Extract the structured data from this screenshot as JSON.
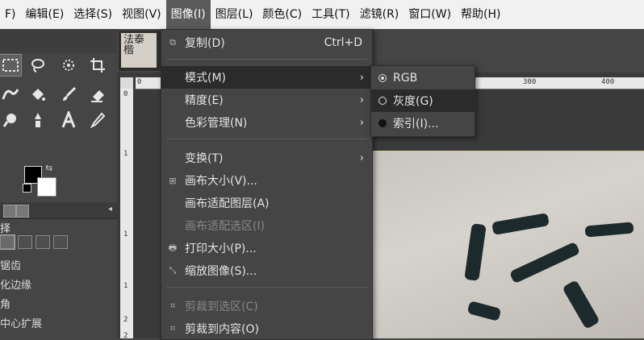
{
  "menubar": [
    {
      "label": "F)"
    },
    {
      "label": "编辑(E)"
    },
    {
      "label": "选择(S)"
    },
    {
      "label": "视图(V)"
    },
    {
      "label": "图像(I)"
    },
    {
      "label": "图层(L)"
    },
    {
      "label": "颜色(C)"
    },
    {
      "label": "工具(T)"
    },
    {
      "label": "滤镜(R)"
    },
    {
      "label": "窗口(W)"
    },
    {
      "label": "帮助(H)"
    }
  ],
  "image_menu": {
    "copy": {
      "label": "复制(D)",
      "shortcut": "Ctrl+D"
    },
    "mode": {
      "label": "模式(M)"
    },
    "precision": {
      "label": "精度(E)"
    },
    "color_mgmt": {
      "label": "色彩管理(N)"
    },
    "transform": {
      "label": "变换(T)"
    },
    "canvas_size": {
      "label": "画布大小(V)..."
    },
    "fit_canvas_layers": {
      "label": "画布适配图层(A)"
    },
    "fit_canvas_selection": {
      "label": "画布适配选区(I)"
    },
    "print_size": {
      "label": "打印大小(P)..."
    },
    "scale_image": {
      "label": "缩放图像(S)..."
    },
    "crop_selection": {
      "label": "剪裁到选区(C)"
    },
    "crop_content": {
      "label": "剪裁到内容(O)"
    }
  },
  "mode_submenu": [
    {
      "label": "RGB"
    },
    {
      "label": "灰度(G)"
    },
    {
      "label": "索引(I)..."
    }
  ],
  "tool_options": {
    "title": "择",
    "lines": [
      "锯齿",
      "化边缘",
      "角",
      "中心扩展"
    ]
  },
  "ruler": {
    "top": [
      "0",
      "300",
      "400"
    ],
    "left": [
      "0",
      "1",
      "1",
      "1",
      "2",
      "2"
    ]
  },
  "thumbnail_text": "法泰楷"
}
